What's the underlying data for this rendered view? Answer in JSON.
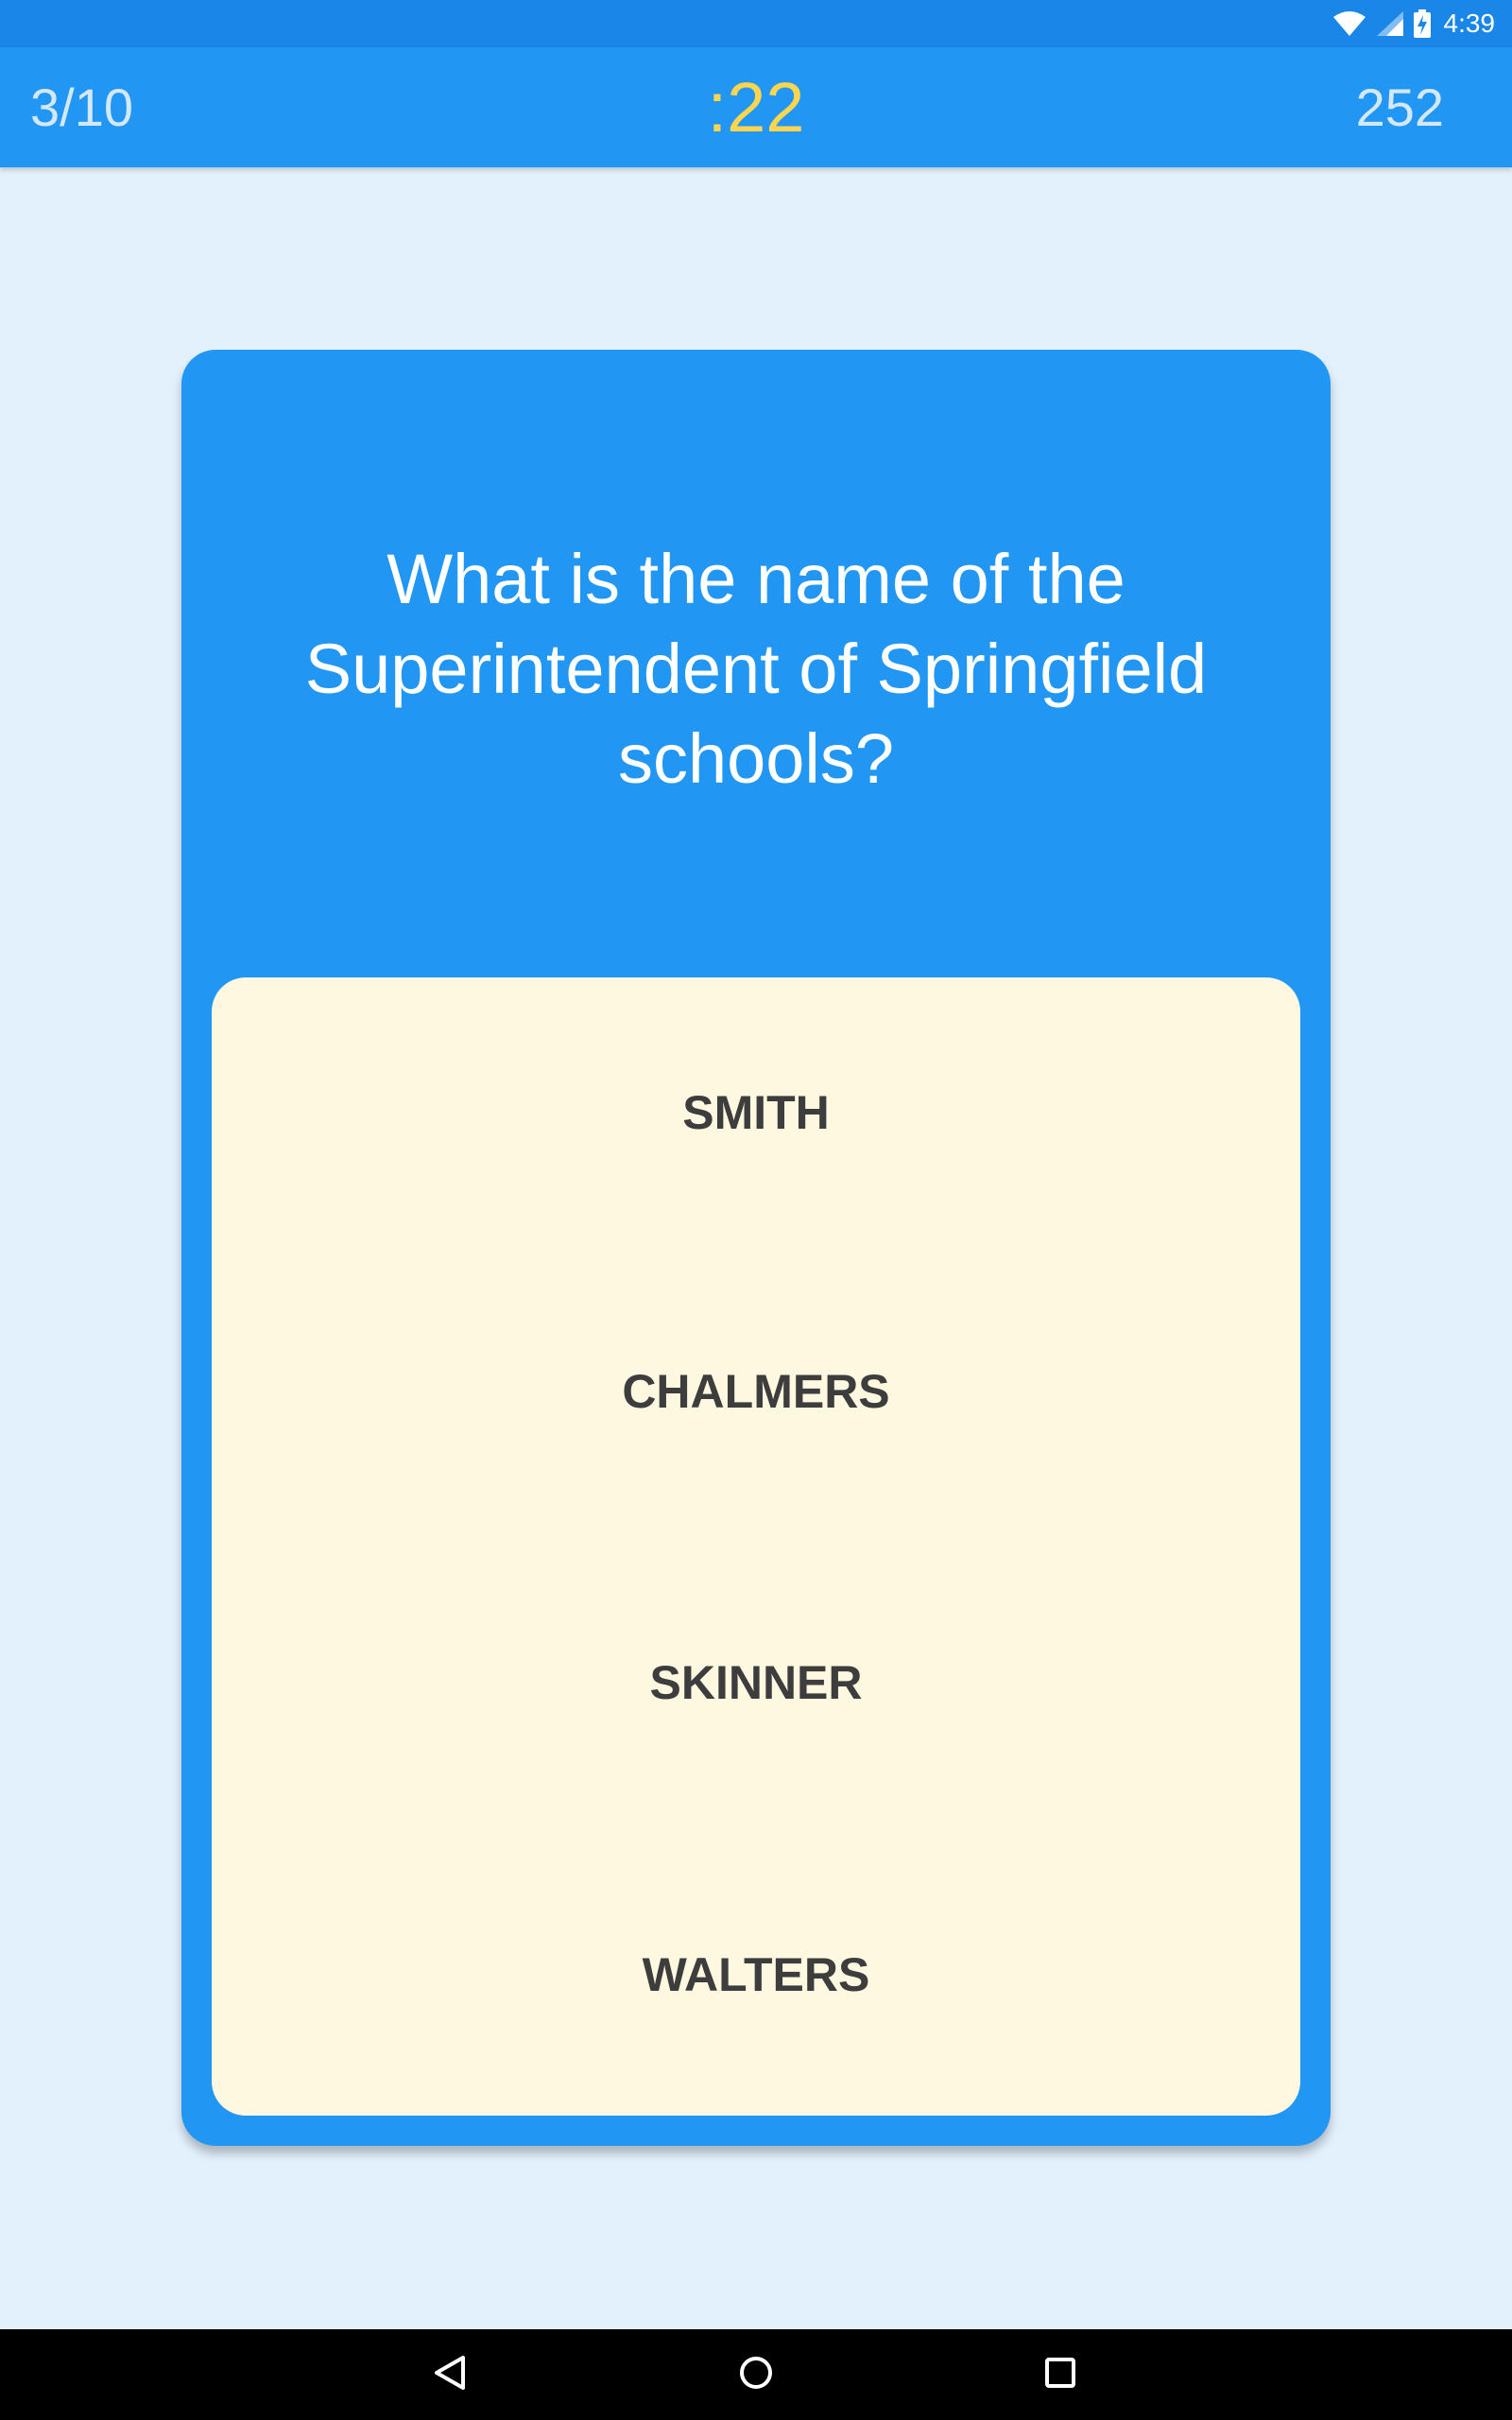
{
  "status_bar": {
    "time": "4:39",
    "icons": [
      "wifi-icon",
      "cell-signal-icon",
      "battery-charging-icon"
    ]
  },
  "header": {
    "progress": "3/10",
    "timer": ":22",
    "score": "252"
  },
  "quiz": {
    "question": "What is the name of the Superintendent of Springfield schools?",
    "answers": [
      "SMITH",
      "CHALMERS",
      "SKINNER",
      "WALTERS"
    ]
  },
  "navigation": {
    "buttons": [
      "back-icon",
      "home-icon",
      "recents-icon"
    ]
  },
  "colors": {
    "status_bar": "#1a86e8",
    "app_bar": "#2196f3",
    "timer": "#ffd54f",
    "background": "#e3f1fd",
    "card": "#2196f3",
    "answers_panel": "#fff8e1",
    "answer_text": "#3d3d3d"
  }
}
